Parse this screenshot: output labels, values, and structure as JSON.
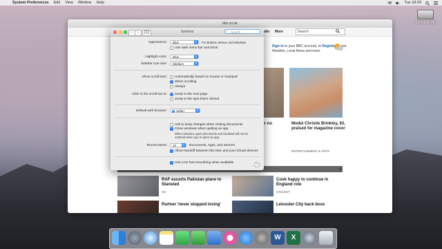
{
  "menubar": {
    "app": "System Preferences",
    "items": [
      "Edit",
      "View",
      "Window",
      "Help"
    ],
    "clock": "Tue 18:24"
  },
  "desktop": {
    "disk_label": "Macintosh HD"
  },
  "safari": {
    "url": "bbc.co.uk",
    "nav_radio": "adio",
    "nav_more": "More",
    "nav_search_label": "Search",
    "signin_text_1": "Sign in",
    "signin_text_2": " to your BBC account, or ",
    "signin_text_3": "Register",
    "signin_text_4": " to see Weather, Local News and more",
    "story1_title": "eal or no\nhen\nrd",
    "story2_title": "Model Christie Brinkley, 63, praised for magazine cover",
    "story2_tag": "ENTERTAINMENT & ARTS",
    "news_header_left": "News Headlines",
    "news_header_right": "Sport Headlines",
    "close_symbol": "✕",
    "news_items": [
      {
        "title": "RAF escorts Pakistan plane to Stansted",
        "tag": "UK"
      },
      {
        "title": "Cook happy to continue in England role",
        "tag": "CRICKET"
      },
      {
        "title": "Partner 'never stopped loving'",
        "tag": ""
      },
      {
        "title": "Leicester City back boss",
        "tag": ""
      }
    ]
  },
  "prefs": {
    "title": "General",
    "search_placeholder": "Search",
    "appearance_label": "Appearance:",
    "appearance_value": "Blue",
    "appearance_note": "For Buttons, Menus, and Windows",
    "dark_menu_label": "Use dark menu bar and Dock",
    "highlight_label": "Highlight color:",
    "highlight_value": "Blue",
    "sidebar_label": "Sidebar icon size:",
    "sidebar_value": "Medium",
    "scroll_label": "Show scroll bars:",
    "scroll_opt1": "Automatically based on mouse or trackpad",
    "scroll_opt2": "When scrolling",
    "scroll_opt3": "Always",
    "click_label": "Click in the scroll bar to:",
    "click_opt1": "Jump to the next page",
    "click_opt2": "Jump to the spot that's clicked",
    "browser_label": "Default web browser:",
    "browser_value": "Safari",
    "ask_changes": "Ask to keep changes when closing documents",
    "close_windows": "Close windows when quitting an app",
    "close_windows_note": "When selected, open documents and windows will not be restored when you re-open an app.",
    "recent_label": "Recent items:",
    "recent_value": "10",
    "recent_note": "Documents, Apps, and Servers",
    "handoff": "Allow Handoff between this Mac and your iCloud devices",
    "lcd": "Use LCD font smoothing when available",
    "help": "?"
  },
  "colors": {
    "accent": "#3d8ef0",
    "close": "#fc605c",
    "minimize": "#fdbc40",
    "zoom": "#34c84a"
  },
  "dock_icons": [
    "finder-icon",
    "launchpad-icon",
    "safari-icon",
    "notes-icon",
    "messages-icon",
    "numbers-icon",
    "keynote-icon",
    "itunes-icon",
    "app-store-icon",
    "system-preferences-icon",
    "word-icon",
    "excel-icon",
    "quicktime-icon",
    "trash-icon"
  ]
}
